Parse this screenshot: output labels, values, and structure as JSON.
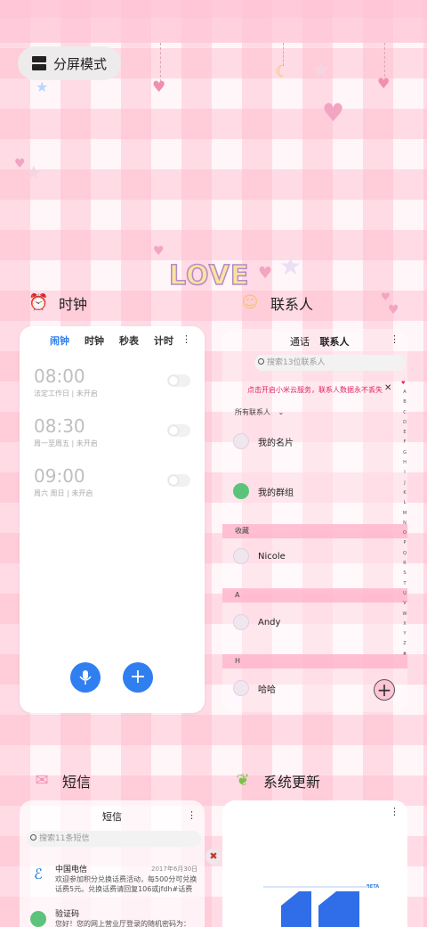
{
  "split_screen": {
    "label": "分屏模式",
    "icon": "split-screen-icon"
  },
  "wallpaper": {
    "love_text": "LOVE"
  },
  "apps": {
    "clock": {
      "title": "时钟",
      "tabs": [
        "闹钟",
        "时钟",
        "秒表",
        "计时"
      ],
      "active_tab": "闹钟",
      "alarms": [
        {
          "time": "08:00",
          "desc": "法定工作日 | 未开启",
          "enabled": false
        },
        {
          "time": "08:30",
          "desc": "周一至周五 | 未开启",
          "enabled": false
        },
        {
          "time": "09:00",
          "desc": "周六 周日 | 未开启",
          "enabled": false
        }
      ],
      "voice_icon": "microphone-icon",
      "add_icon": "plus-icon"
    },
    "contacts": {
      "title": "联系人",
      "tabs": [
        "通话",
        "联系人"
      ],
      "search_placeholder": "搜索13位联系人",
      "banner": "点击开启小米云服务，联系人数据永不丢失",
      "group_filter": "所有联系人",
      "rows": [
        {
          "name": "我的名片"
        },
        {
          "name": "我的群组"
        }
      ],
      "sections": [
        {
          "header": "收藏",
          "name": "Nicole"
        },
        {
          "header": "A",
          "name": "Andy"
        },
        {
          "header": "H",
          "name": "哈哈"
        }
      ],
      "index_letters": [
        "A",
        "B",
        "C",
        "D",
        "E",
        "F",
        "G",
        "H",
        "I",
        "J",
        "K",
        "L",
        "M",
        "N",
        "O",
        "P",
        "Q",
        "R",
        "S",
        "T",
        "U",
        "V",
        "W",
        "X",
        "Y",
        "Z",
        "#"
      ]
    },
    "sms": {
      "title": "短信",
      "search_placeholder": "搜索11条短信",
      "messages": [
        {
          "sender": "中国电信",
          "date": "2017年6月30日",
          "preview": "欢迎参加积分兑换话费活动，每500分可兑换话费5元。兑换话费请回复106或jfdh#话费金额..."
        },
        {
          "sender": "验证码",
          "date": "",
          "preview": "您好！您的网上营业厅登录的随机密码为："
        }
      ]
    },
    "update": {
      "title": "系统更新",
      "badge": "BETA"
    }
  },
  "colors": {
    "accent": "#2f7ff0",
    "pink": "#ffb6cd",
    "banner_text": "#e0245e"
  }
}
